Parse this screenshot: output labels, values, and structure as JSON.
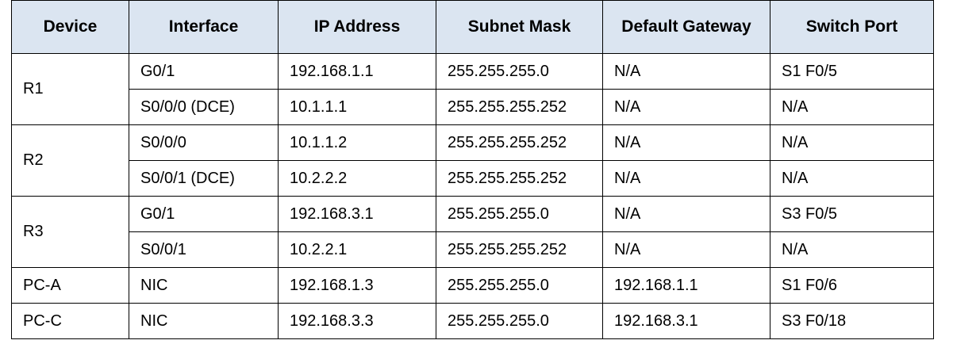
{
  "table": {
    "headers": [
      "Device",
      "Interface",
      "IP Address",
      "Subnet Mask",
      "Default Gateway",
      "Switch Port"
    ],
    "rows": [
      {
        "device": "R1",
        "interface": "G0/1",
        "ip": "192.168.1.1",
        "mask": "255.255.255.0",
        "gateway": "N/A",
        "port": "S1 F0/5"
      },
      {
        "device": "",
        "interface": "S0/0/0 (DCE)",
        "ip": "10.1.1.1",
        "mask": "255.255.255.252",
        "gateway": "N/A",
        "port": "N/A"
      },
      {
        "device": "R2",
        "interface": "S0/0/0",
        "ip": "10.1.1.2",
        "mask": "255.255.255.252",
        "gateway": "N/A",
        "port": "N/A"
      },
      {
        "device": "",
        "interface": "S0/0/1 (DCE)",
        "ip": "10.2.2.2",
        "mask": "255.255.255.252",
        "gateway": "N/A",
        "port": "N/A"
      },
      {
        "device": "R3",
        "interface": "G0/1",
        "ip": "192.168.3.1",
        "mask": "255.255.255.0",
        "gateway": "N/A",
        "port": "S3 F0/5"
      },
      {
        "device": "",
        "interface": "S0/0/1",
        "ip": "10.2.2.1",
        "mask": "255.255.255.252",
        "gateway": "N/A",
        "port": "N/A"
      },
      {
        "device": "PC-A",
        "interface": "NIC",
        "ip": "192.168.1.3",
        "mask": "255.255.255.0",
        "gateway": "192.168.1.1",
        "port": "S1 F0/6"
      },
      {
        "device": "PC-C",
        "interface": "NIC",
        "ip": "192.168.3.3",
        "mask": "255.255.255.0",
        "gateway": "192.168.3.1",
        "port": "S3 F0/18"
      }
    ]
  },
  "colors": {
    "header_bg": "#dbe5f1",
    "border": "#000000"
  }
}
